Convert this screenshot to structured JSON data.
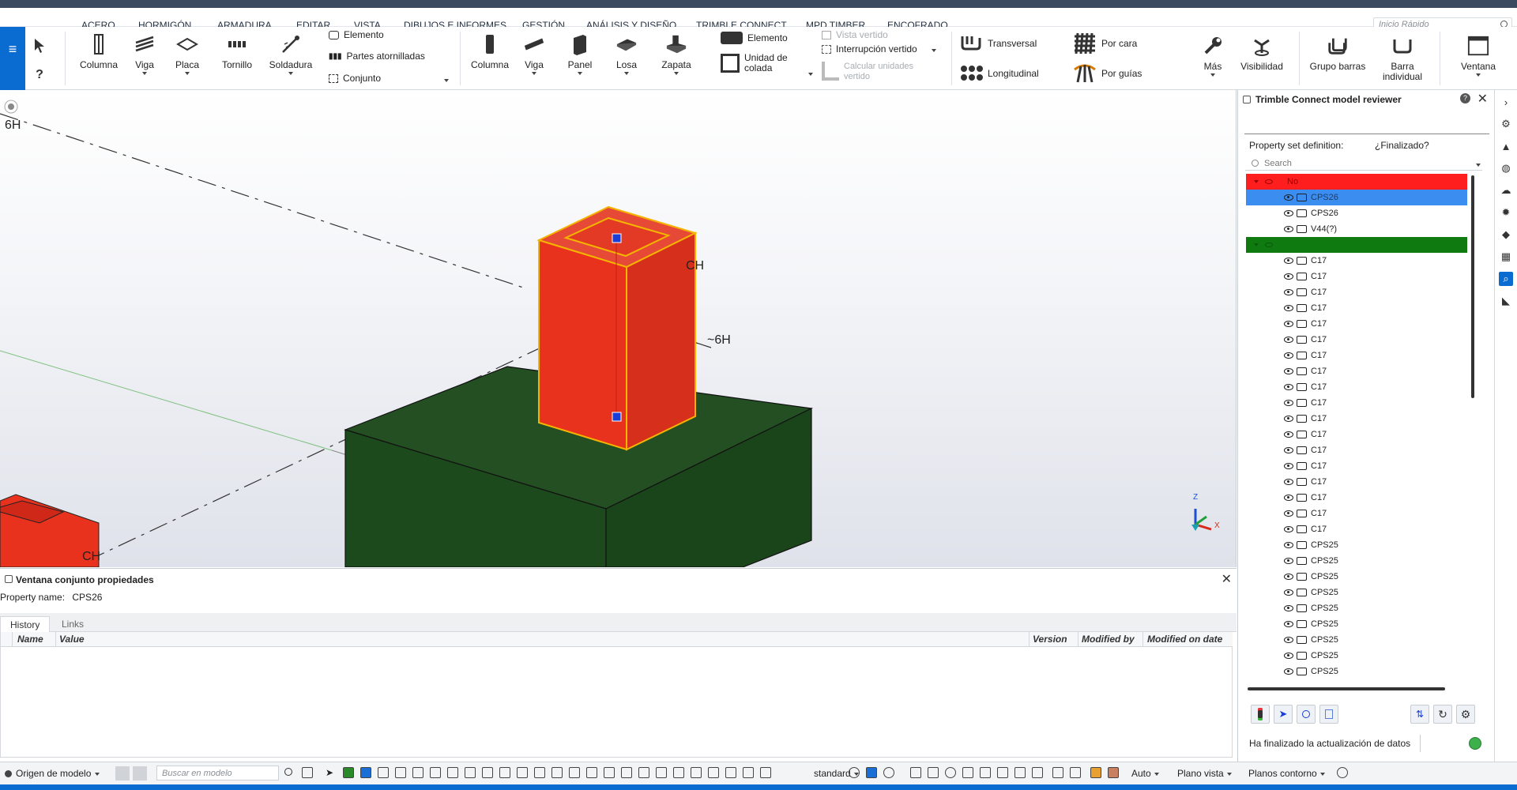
{
  "menu": {
    "items": [
      "ACERO",
      "HORMIGÓN",
      "ARMADURA",
      "EDITAR",
      "VISTA",
      "DIBUJOS E INFORMES",
      "GESTIÓN",
      "ANÁLISIS Y DISEÑO",
      "TRIMBLE CONNECT",
      "MPD TIMBER",
      "ENCOFRADO"
    ],
    "active_index": 0,
    "quick_launch_placeholder": "Inicio Rápido"
  },
  "ribbon": {
    "steel": {
      "columna": "Columna",
      "viga": "Viga",
      "placa": "Placa",
      "tornillo": "Tornillo",
      "soldadura": "Soldadura",
      "elemento": "Elemento",
      "partes_atornilladas": "Partes atornilladas",
      "conjunto": "Conjunto"
    },
    "concrete": {
      "columna": "Columna",
      "viga": "Viga",
      "panel": "Panel",
      "losa": "Losa",
      "zapata": "Zapata",
      "elemento": "Elemento",
      "unidad_colada_1": "Unidad de",
      "unidad_colada_2": "colada",
      "vista_vertido": "Vista vertido",
      "interrupcion_vertido": "Interrupción vertido",
      "calcular_1": "Calcular unidades",
      "calcular_2": "vertido"
    },
    "rebar": {
      "transversal": "Transversal",
      "longitudinal": "Longitudinal",
      "por_cara": "Por cara",
      "por_guias": "Por guías"
    },
    "mas": "Más",
    "visibilidad": "Visibilidad",
    "grupo_barras": "Grupo barras",
    "barra_1": "Barra",
    "barra_2": "individual",
    "ventana": "Ventana"
  },
  "viewport": {
    "grid_labels": [
      "6H",
      "CH",
      "~6H",
      "CH"
    ],
    "axis": {
      "z": "Z",
      "x": "X"
    },
    "colors": {
      "column": "#e8321e",
      "footing": "#1f4a1f",
      "highlight": "#f5b400",
      "handle": "#1a3fd6"
    }
  },
  "bottom_panel": {
    "title": "Ventana conjunto propiedades",
    "property_name_label": "Property name:",
    "property_name_value": "CPS26",
    "tabs": [
      "History",
      "Links"
    ],
    "active_tab": 0,
    "columns": [
      "Name",
      "Value",
      "Version",
      "Modified by",
      "Modified on date"
    ]
  },
  "right_panel": {
    "title": "Trimble Connect model reviewer",
    "help": "?",
    "property_set_label": "Property set definition:",
    "property_set_value": "¿Finalizado?",
    "search_placeholder": "Search",
    "tree": [
      {
        "type": "group",
        "label": "No",
        "color": "red"
      },
      {
        "type": "item",
        "label": "CPS26",
        "selected": true
      },
      {
        "type": "item",
        "label": "CPS26"
      },
      {
        "type": "item",
        "label": "V44(?)"
      },
      {
        "type": "group",
        "label": "",
        "color": "green"
      },
      {
        "type": "item",
        "label": "C17"
      },
      {
        "type": "item",
        "label": "C17"
      },
      {
        "type": "item",
        "label": "C17"
      },
      {
        "type": "item",
        "label": "C17"
      },
      {
        "type": "item",
        "label": "C17"
      },
      {
        "type": "item",
        "label": "C17"
      },
      {
        "type": "item",
        "label": "C17"
      },
      {
        "type": "item",
        "label": "C17"
      },
      {
        "type": "item",
        "label": "C17"
      },
      {
        "type": "item",
        "label": "C17"
      },
      {
        "type": "item",
        "label": "C17"
      },
      {
        "type": "item",
        "label": "C17"
      },
      {
        "type": "item",
        "label": "C17"
      },
      {
        "type": "item",
        "label": "C17"
      },
      {
        "type": "item",
        "label": "C17"
      },
      {
        "type": "item",
        "label": "C17"
      },
      {
        "type": "item",
        "label": "C17"
      },
      {
        "type": "item",
        "label": "C17"
      },
      {
        "type": "item",
        "label": "CPS25"
      },
      {
        "type": "item",
        "label": "CPS25"
      },
      {
        "type": "item",
        "label": "CPS25"
      },
      {
        "type": "item",
        "label": "CPS25"
      },
      {
        "type": "item",
        "label": "CPS25"
      },
      {
        "type": "item",
        "label": "CPS25"
      },
      {
        "type": "item",
        "label": "CPS25"
      },
      {
        "type": "item",
        "label": "CPS25"
      },
      {
        "type": "item",
        "label": "CPS25"
      }
    ],
    "status_text": "Ha finalizado la actualización de datos"
  },
  "statusbar": {
    "origin": "Origen de modelo",
    "search_placeholder": "Buscar en modelo",
    "standard": "standard",
    "auto": "Auto",
    "plano_vista": "Plano vista",
    "planos_contorno": "Planos contorno"
  }
}
